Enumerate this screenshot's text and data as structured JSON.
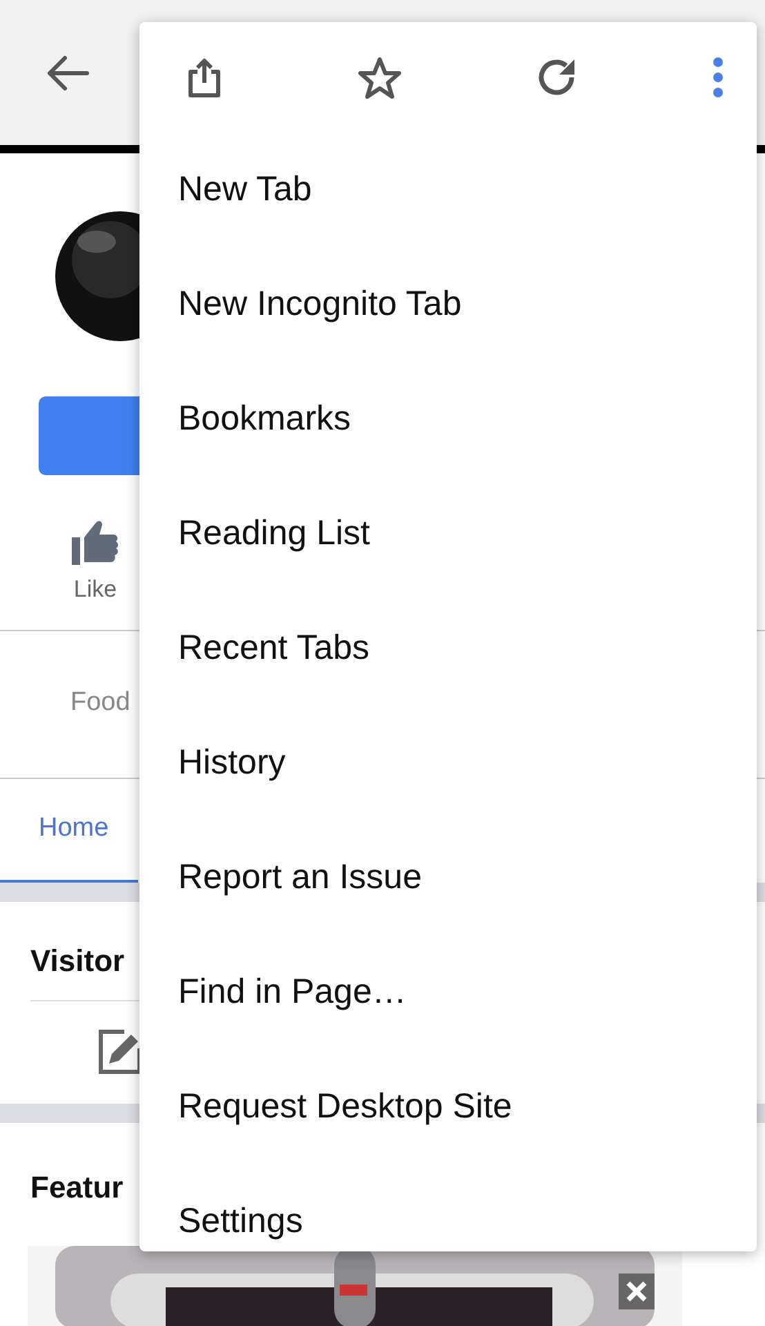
{
  "page": {
    "like_label": "Like",
    "category": "Food",
    "tab": {
      "label": "Home",
      "selected": true
    },
    "visitor_heading": "Visitor",
    "featured_heading": "Featur"
  },
  "menu": {
    "items": [
      {
        "label": "New Tab"
      },
      {
        "label": "New Incognito Tab"
      },
      {
        "label": "Bookmarks"
      },
      {
        "label": "Reading List"
      },
      {
        "label": "Recent Tabs"
      },
      {
        "label": "History"
      },
      {
        "label": "Report an Issue"
      },
      {
        "label": "Find in Page…"
      },
      {
        "label": "Request Desktop Site"
      },
      {
        "label": "Settings"
      }
    ]
  }
}
